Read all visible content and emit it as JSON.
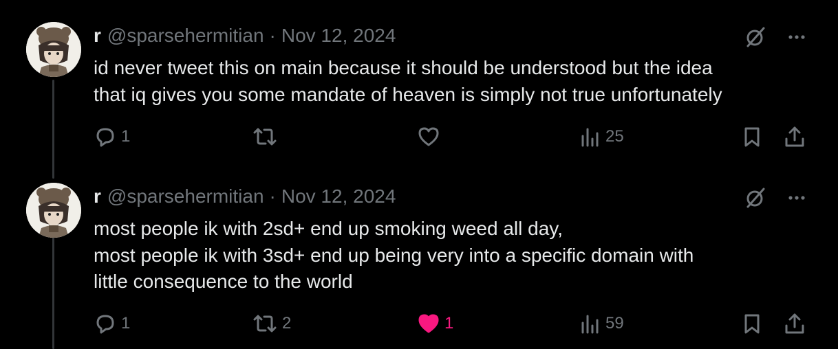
{
  "tweets": [
    {
      "name": "r",
      "handle": "@sparsehermitian",
      "separator": "·",
      "date": "Nov 12, 2024",
      "text": "id never tweet this on main because it should be understood but the idea\nthat iq gives you some mandate of heaven is simply not true unfortunately",
      "stats": {
        "replies": "1",
        "retweets": "",
        "likes": "",
        "views": "25"
      },
      "liked": false
    },
    {
      "name": "r",
      "handle": "@sparsehermitian",
      "separator": "·",
      "date": "Nov 12, 2024",
      "text": "most people ik with 2sd+ end up smoking weed all day,\nmost people ik with 3sd+ end up being very into a specific domain with\nlittle consequence to the world",
      "stats": {
        "replies": "1",
        "retweets": "2",
        "likes": "1",
        "views": "59"
      },
      "liked": true
    }
  ],
  "colors": {
    "background": "#000000",
    "text": "#e7e9ea",
    "muted": "#71767b",
    "like_active": "#f91880",
    "thread_line": "#333639"
  }
}
